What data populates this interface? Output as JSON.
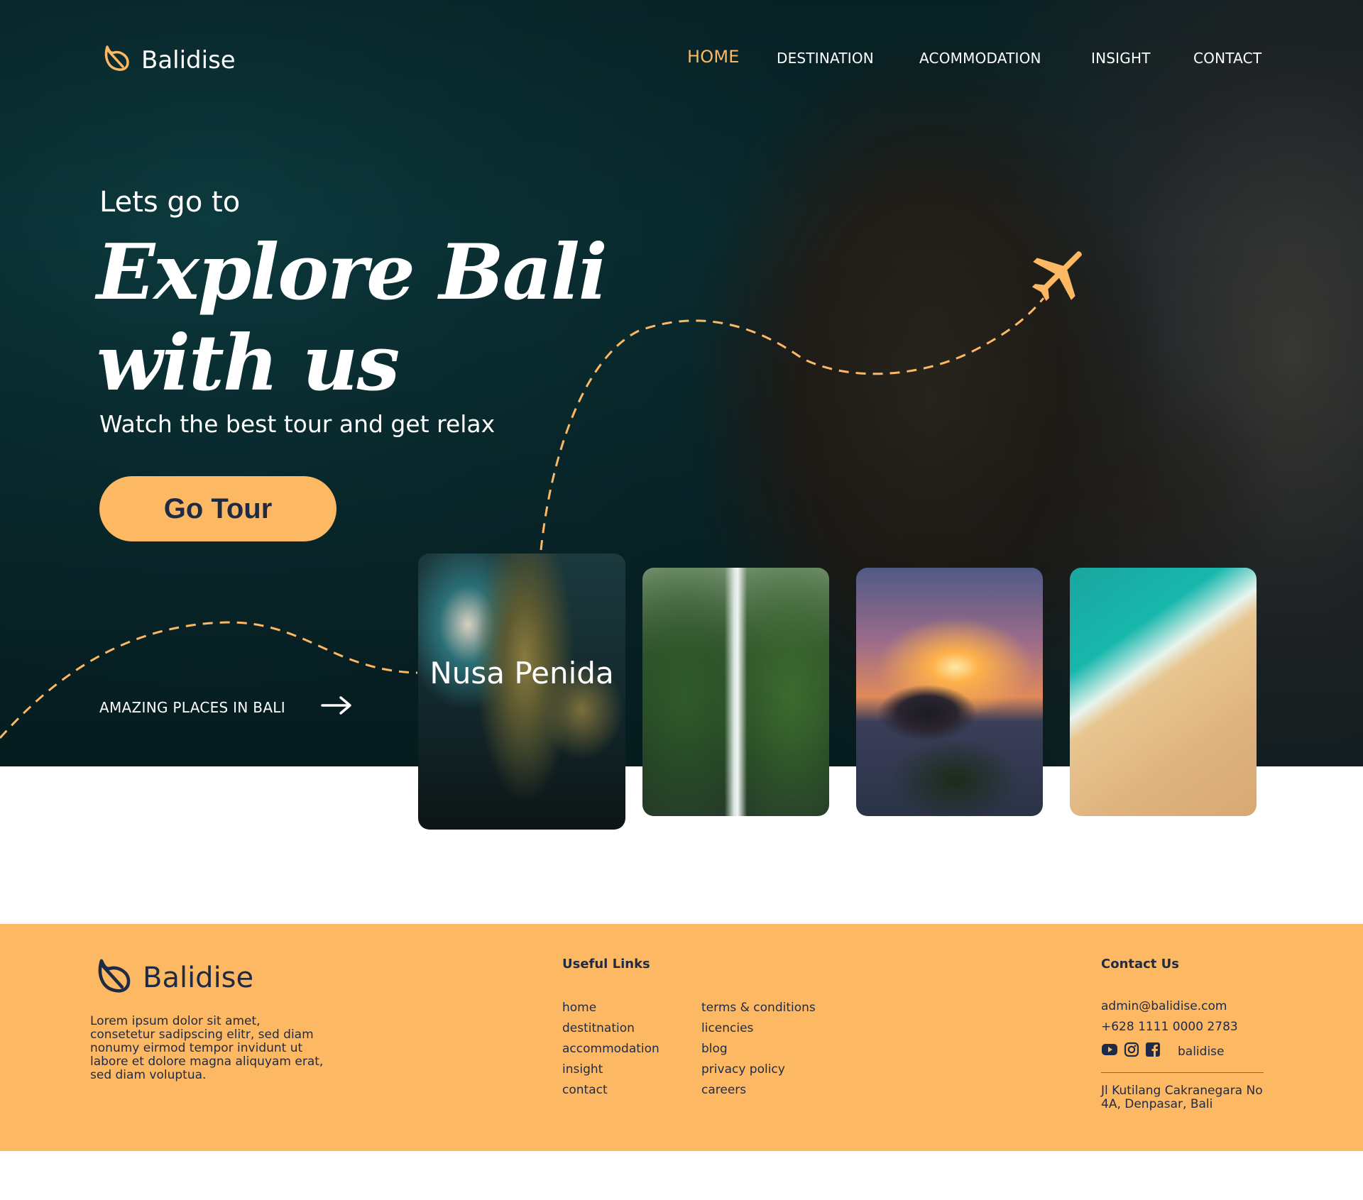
{
  "brand": {
    "name": "Balidise",
    "icon": "leaf-icon"
  },
  "nav": {
    "items": [
      {
        "label": "HOME",
        "active": true
      },
      {
        "label": "DESTINATION",
        "active": false
      },
      {
        "label": "ACOMMODATION",
        "active": false
      },
      {
        "label": "INSIGHT",
        "active": false
      },
      {
        "label": "CONTACT",
        "active": false
      }
    ]
  },
  "hero": {
    "eyebrow": "Lets go to",
    "headline_line1": "Explore Bali",
    "headline_line2": "with us",
    "subline": "Watch the best tour and get relax",
    "cta_label": "Go Tour",
    "places_label": "AMAZING PLACES IN BALI",
    "places_icon": "arrow-right-icon",
    "plane_icon": "airplane-icon"
  },
  "cards": [
    {
      "title": "Nusa Penida",
      "image": "nusa-penida-coast"
    },
    {
      "title": "",
      "image": "jungle-waterfall"
    },
    {
      "title": "",
      "image": "temple-sunset"
    },
    {
      "title": "",
      "image": "aerial-beach"
    }
  ],
  "footer": {
    "about": "Lorem ipsum dolor sit amet, consetetur sadipscing elitr, sed diam nonumy eirmod tempor invidunt ut labore et dolore magna aliquyam erat, sed diam voluptua.",
    "useful_links_heading": "Useful Links",
    "links_col1": [
      "home",
      "destitnation",
      "accommodation",
      "insight",
      "contact"
    ],
    "links_col2": [
      "terms & conditions",
      "licencies",
      "blog",
      "privacy policy",
      "careers"
    ],
    "contact_heading": "Contact Us",
    "email": "admin@balidise.com",
    "phone": "+628 1111 0000 2783",
    "social_icons": [
      "youtube-icon",
      "instagram-icon",
      "facebook-icon"
    ],
    "social_handle": "balidise",
    "address": "Jl Kutilang Cakranegara No 4A, Denpasar, Bali"
  },
  "colors": {
    "accent": "#fdb863",
    "navy": "#1f2a44",
    "hero_bg": "#0a2b2f",
    "white": "#ffffff"
  }
}
